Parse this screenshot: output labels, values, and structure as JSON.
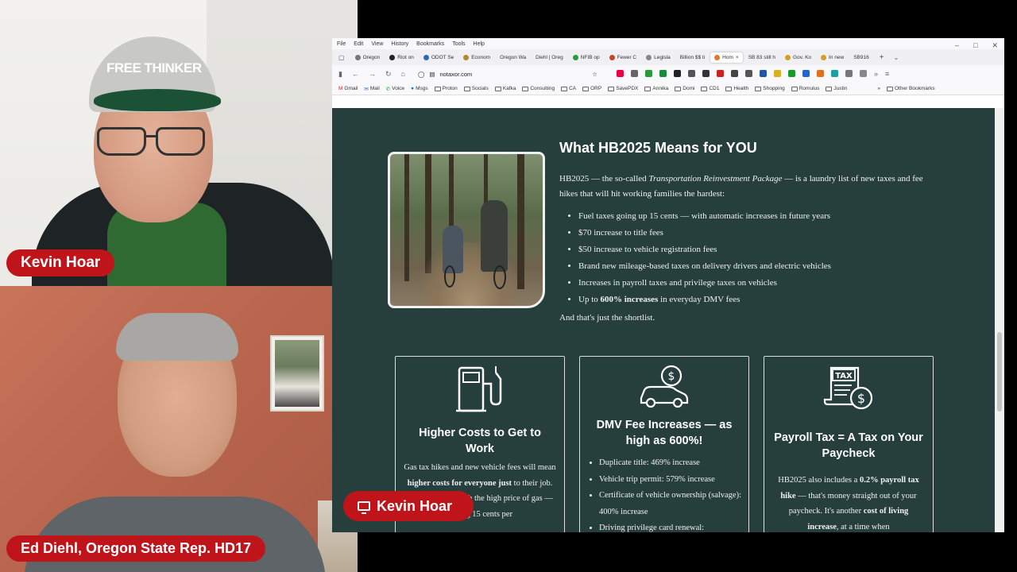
{
  "participants": {
    "top": {
      "name": "Kevin Hoar",
      "cap_text": "FREE THINKER"
    },
    "bottom": {
      "name": "Ed Diehl, Oregon State Rep. HD17"
    },
    "screen_share_label": "Kevin Hoar"
  },
  "browser": {
    "menu": [
      "File",
      "Edit",
      "View",
      "History",
      "Bookmarks",
      "Tools",
      "Help"
    ],
    "tabs": [
      "Oregon",
      "Riot on",
      "ODOT Se",
      "Econom",
      "Oregon Wa",
      "Diehl | Oreg",
      "NFIB op",
      "Fewer C",
      "Legisla",
      "Billion $$ ti",
      "Hom",
      "SB 83 still h",
      "Gov. Ko",
      "In new",
      "SB916"
    ],
    "active_tab_index": 10,
    "url": "notaxor.com",
    "bookmarks": [
      "Gmail",
      "Mail",
      "Voice",
      "Msgs",
      "Proton",
      "Socials",
      "Kafka",
      "Consulting",
      "CA",
      "ORP",
      "SavePDX",
      "Annika",
      "Domi",
      "CD1",
      "Health",
      "Shopping",
      "Romulus",
      "Justin"
    ],
    "other_bookmarks": "Other Bookmarks"
  },
  "page": {
    "title": "What HB2025 Means for YOU",
    "intro_a": "HB2025 — the so-called ",
    "intro_em": "Transportation Reinvestment Package",
    "intro_b": " — is a laundry list of new taxes and fee hikes that will hit working families the hardest:",
    "bullets": [
      "Fuel taxes going up 15 cents — with automatic increases in future years",
      "$70 increase to title fees",
      "$50 increase to vehicle registration fees",
      "Brand new mileage-based taxes on delivery drivers and electric vehicles",
      "Increases in payroll taxes and privilege taxes on vehicles"
    ],
    "bullet_last_a": "Up to ",
    "bullet_last_b": "600% increases",
    "bullet_last_c": " in everyday DMV fees",
    "shortlist": "And that's just the shortlist.",
    "cards": [
      {
        "title": "Higher Costs to Get to Work",
        "body_a": "Gas tax hikes and new vehicle fees will mean ",
        "body_b": "higher costs for everyone just",
        "body_c": " to their job. Many struggle with the high price of gas — adding 15 cents per"
      },
      {
        "title": "DMV Fee Increases — as high as 600%!",
        "items": [
          "Duplicate title: 469% increase",
          "Vehicle trip permit: 579% increase",
          "Certificate of vehicle ownership (salvage): 400% increase",
          "Driving privilege card renewal:"
        ]
      },
      {
        "title": "Payroll Tax = A Tax on Your Paycheck",
        "body_a": "HB2025 also includes a ",
        "body_b": "0.2% payroll tax hike",
        "body_c": " — that's money straight out of your paycheck. It's another ",
        "body_d": "cost of living increase",
        "body_e": ", at a time when"
      }
    ]
  }
}
